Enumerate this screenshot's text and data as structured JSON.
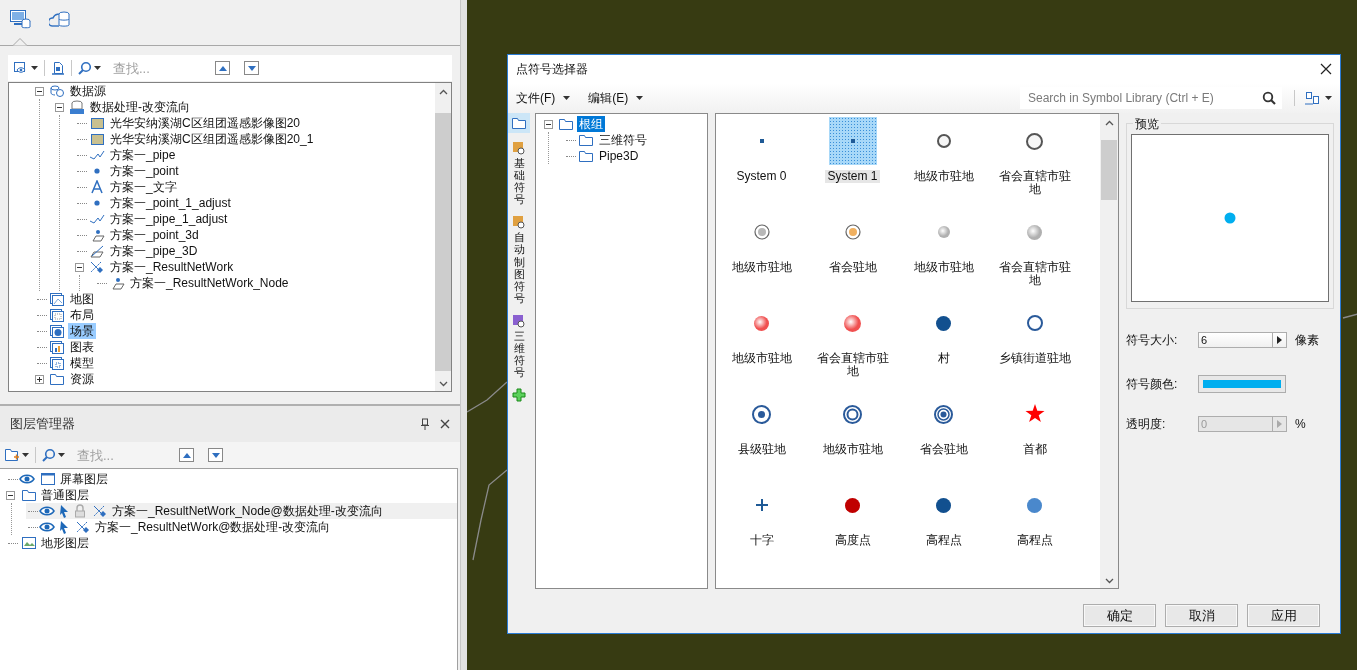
{
  "explorer": {
    "tabs": [
      {
        "kind": "workspace",
        "selected": true
      },
      {
        "kind": "cloud",
        "selected": false
      }
    ],
    "toolbar": {
      "search_placeholder": "查找..."
    },
    "tree": [
      {
        "label": "数据源",
        "kind": "datasource",
        "expanded": true,
        "selected": false,
        "children": [
          {
            "label": "数据处理-改变流向",
            "kind": "udb",
            "expanded": true,
            "selected": false,
            "children": [
              {
                "label": "光华安纳溪湖C区组团遥感影像图20",
                "kind": "image",
                "selected": false
              },
              {
                "label": "光华安纳溪湖C区组团遥感影像图20_1",
                "kind": "image",
                "selected": false
              },
              {
                "label": "方案一_pipe",
                "kind": "line",
                "selected": false
              },
              {
                "label": "方案一_point",
                "kind": "point",
                "selected": false
              },
              {
                "label": "方案一_文字",
                "kind": "text",
                "selected": false
              },
              {
                "label": "方案一_point_1_adjust",
                "kind": "point",
                "selected": false
              },
              {
                "label": "方案一_pipe_1_adjust",
                "kind": "line",
                "selected": false
              },
              {
                "label": "方案一_point_3d",
                "kind": "point3d",
                "selected": false
              },
              {
                "label": "方案一_pipe_3D",
                "kind": "line3d",
                "selected": false
              },
              {
                "label": "方案一_ResultNetWork",
                "kind": "network",
                "expanded": true,
                "selected": false,
                "children": [
                  {
                    "label": "方案一_ResultNetWork_Node",
                    "kind": "point3d",
                    "selected": false
                  }
                ]
              }
            ]
          }
        ]
      },
      {
        "label": "地图",
        "kind": "map",
        "selected": false
      },
      {
        "label": "布局",
        "kind": "layout",
        "selected": false
      },
      {
        "label": "场景",
        "kind": "scene",
        "selected": true
      },
      {
        "label": "图表",
        "kind": "chart",
        "selected": false
      },
      {
        "label": "模型",
        "kind": "model",
        "selected": false
      },
      {
        "label": "资源",
        "kind": "resource",
        "expanded": false,
        "selected": false
      }
    ]
  },
  "layer_manager": {
    "title": "图层管理器",
    "toolbar": {
      "search_placeholder": "查找..."
    },
    "tree": [
      {
        "label": "屏幕图层",
        "kind": "screen",
        "visible": true,
        "selected": false
      },
      {
        "label": "普通图层",
        "kind": "group",
        "expanded": true,
        "selected": false,
        "children": [
          {
            "label": "方案一_ResultNetWork_Node@数据处理-改变流向",
            "kind": "network",
            "visible": true,
            "selectable": true,
            "locked": true,
            "selected": true
          },
          {
            "label": "方案一_ResultNetWork@数据处理-改变流向",
            "kind": "network",
            "visible": true,
            "selectable": true,
            "locked": false,
            "selected": false
          }
        ]
      },
      {
        "label": "地形图层",
        "kind": "terrain",
        "selected": false
      }
    ]
  },
  "dialog": {
    "title": "点符号选择器",
    "menus": [
      {
        "label": "文件(F)"
      },
      {
        "label": "编辑(E)"
      }
    ],
    "search_placeholder": "Search in Symbol Library (Ctrl + E)",
    "side_tabs": [
      {
        "kind": "folder",
        "selected": true
      },
      {
        "kind": "tab",
        "label": "基础符号",
        "selected": false
      },
      {
        "kind": "tab",
        "label": "自动制图符号",
        "selected": false
      },
      {
        "kind": "tab",
        "label": "三维符号",
        "selected": false
      },
      {
        "kind": "add"
      }
    ],
    "group_tree": [
      {
        "label": "根组",
        "expanded": true,
        "selected": true,
        "children": [
          {
            "label": "三维符号",
            "selected": false
          },
          {
            "label": "Pipe3D",
            "selected": false
          }
        ]
      }
    ],
    "symbols": [
      {
        "label": "System 0",
        "kind": "square",
        "color": "#1f5a96",
        "selected": false
      },
      {
        "label": "System 1",
        "kind": "dot",
        "color": "#1f5a96",
        "selected": true
      },
      {
        "label": "地级市驻地",
        "kind": "ring",
        "color": "#555555",
        "selected": false
      },
      {
        "label": "省会直辖市驻地",
        "kind": "ring-large",
        "color": "#555555",
        "selected": false
      },
      {
        "label": "地级市驻地",
        "kind": "bullseye",
        "color": "#b8b8b8",
        "selected": false
      },
      {
        "label": "省会驻地",
        "kind": "bullseye",
        "color": "#f0b060",
        "selected": false
      },
      {
        "label": "地级市驻地",
        "kind": "ball",
        "color": "#b0b0b0",
        "selected": false
      },
      {
        "label": "省会直辖市驻地",
        "kind": "ball-large",
        "color": "#b0b0b0",
        "selected": false
      },
      {
        "label": "地级市驻地",
        "kind": "glow",
        "color": "#f05050",
        "selected": false
      },
      {
        "label": "省会直辖市驻地",
        "kind": "glow-large",
        "color": "#f05050",
        "selected": false
      },
      {
        "label": "村",
        "kind": "filled",
        "color": "#12508f",
        "selected": false
      },
      {
        "label": "乡镇街道驻地",
        "kind": "ring-thin",
        "color": "#2a5a9a",
        "selected": false
      },
      {
        "label": "县级驻地",
        "kind": "dot-ring",
        "color": "#2a5a9a",
        "selected": false
      },
      {
        "label": "地级市驻地",
        "kind": "double-ring",
        "color": "#2a5a9a",
        "selected": false
      },
      {
        "label": "省会驻地",
        "kind": "triple-ring",
        "color": "#2a5a9a",
        "selected": false
      },
      {
        "label": "首都",
        "kind": "star",
        "color": "#ff0000",
        "selected": false
      },
      {
        "label": "十字",
        "kind": "cross",
        "color": "#1f5a96",
        "selected": false
      },
      {
        "label": "高度点",
        "kind": "filled",
        "color": "#c00000",
        "selected": false
      },
      {
        "label": "高程点",
        "kind": "filled",
        "color": "#12508f",
        "selected": false
      },
      {
        "label": "高程点",
        "kind": "filled",
        "color": "#4a88cc",
        "selected": false
      }
    ],
    "preview": {
      "title": "预览"
    },
    "settings": {
      "size_label": "符号大小:",
      "size": "6",
      "size_unit": "像素",
      "color_label": "符号颜色:",
      "color": "#00aeef",
      "opacity_label": "透明度:",
      "opacity": "0",
      "opacity_unit": "%",
      "opacity_disabled": true
    },
    "buttons": [
      {
        "label": "确定"
      },
      {
        "label": "取消"
      },
      {
        "label": "应用"
      }
    ]
  }
}
